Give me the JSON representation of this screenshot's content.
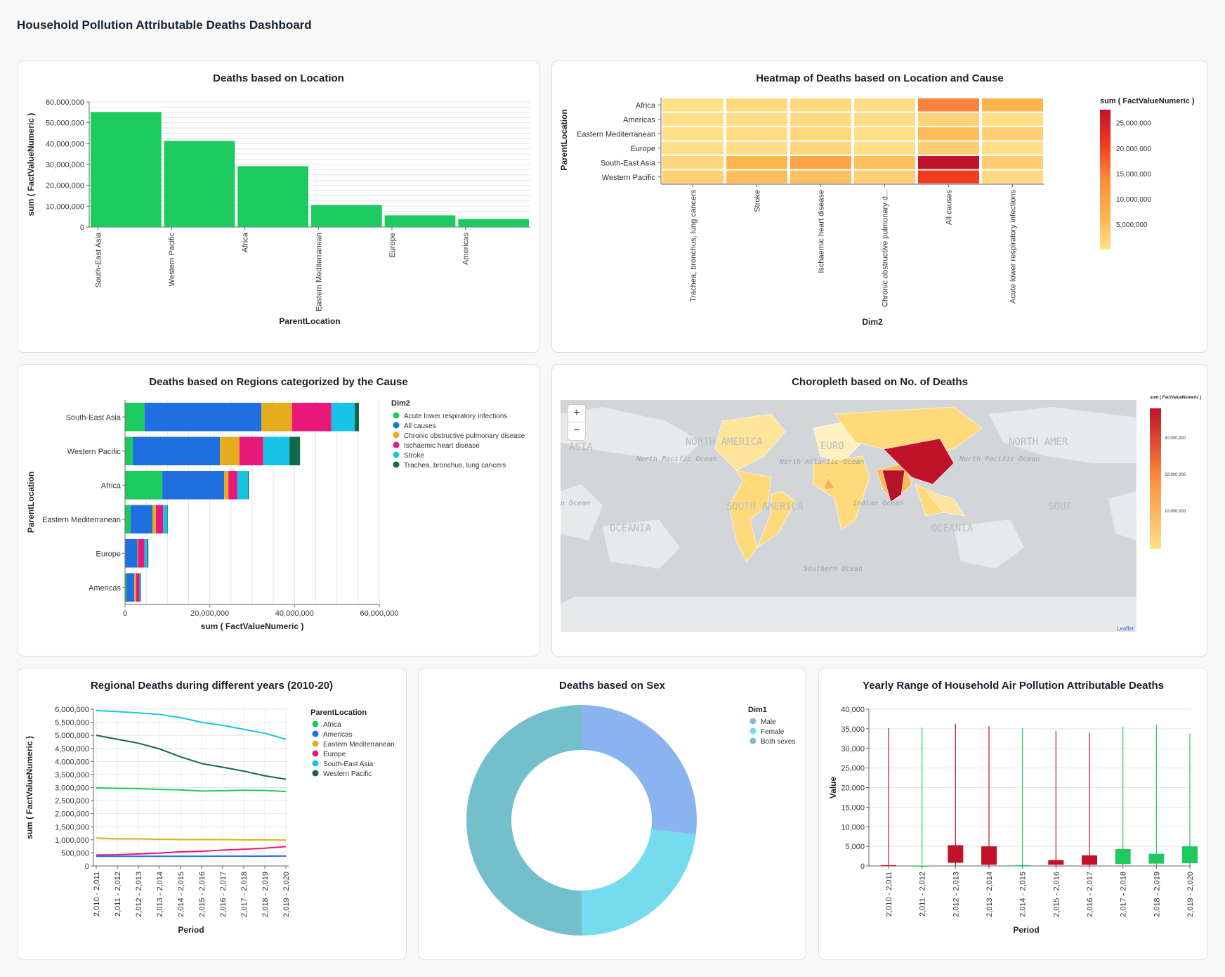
{
  "dashboard_title": "Household Pollution Attributable Deaths Dashboard",
  "cards": {
    "location": {
      "title": "Deaths based on Location"
    },
    "heatmap": {
      "title": "Heatmap of Deaths based on Location and Cause"
    },
    "stacked": {
      "title": "Deaths based on Regions categorized by the Cause"
    },
    "choropleth": {
      "title": "Choropleth based on No. of Deaths"
    },
    "yearly_lines": {
      "title": "Regional Deaths during different years (2010-20)"
    },
    "sex": {
      "title": "Deaths based on Sex"
    },
    "range": {
      "title": "Yearly Range of Household Air Pollution Attributable Deaths"
    }
  },
  "map": {
    "zoom_in": "+",
    "zoom_out": "−",
    "attribution": "Leaflet",
    "legend_title": "sum ( FactValueNumeric )",
    "legend_ticks": [
      "30,000,000",
      "20,000,000",
      "10,000,000"
    ],
    "labels": [
      "ASIA",
      "NORTH AMERICA",
      "EURO",
      "NORTH AMER",
      "North Pacific Ocean",
      "North Atlantic Ocean",
      "North Pacific Ocean",
      "SOUTH AMERICA",
      "Indian Ocean",
      "OCEANIA",
      "OCEANIA",
      "Southern Ocean",
      "n Ocean",
      "SOUT"
    ],
    "colors": {
      "ocean": "#d3d6d9",
      "land": "#e8e9ea",
      "low": "#ffd97a",
      "high": "#c0132a"
    }
  },
  "chart_data": [
    {
      "id": "location",
      "type": "bar",
      "title": "Deaths based on Location",
      "xlabel": "ParentLocation",
      "ylabel": "sum ( FactValueNumeric )",
      "categories": [
        "South-East Asia",
        "Western Pacific",
        "Africa",
        "Eastern Mediterranean",
        "Europe",
        "Americas"
      ],
      "values": [
        55200000,
        41300000,
        29200000,
        10500000,
        5600000,
        3800000
      ],
      "ylim": [
        0,
        60000000
      ],
      "yticks": [
        "0",
        "10,000,000",
        "20,000,000",
        "30,000,000",
        "40,000,000",
        "50,000,000",
        "60,000,000"
      ],
      "color": "#1dca5f",
      "grid": true
    },
    {
      "id": "heatmap",
      "type": "heatmap",
      "title": "Heatmap of Deaths based on Location and Cause",
      "xlabel": "Dim2",
      "ylabel": "ParentLocation",
      "y": [
        "Africa",
        "Americas",
        "Eastern Mediterranean",
        "Europe",
        "South-East Asia",
        "Western Pacific"
      ],
      "x": [
        "Trachea, bronchus, lung cancers",
        "Stroke",
        "Ischaemic heart disease",
        "Chronic obstructive pulmonary d...",
        "All causes",
        "Acute lower respiratory infections"
      ],
      "values": [
        [
          200000,
          1100000,
          1100000,
          300000,
          14600000,
          6800000
        ],
        [
          200000,
          400000,
          900000,
          400000,
          1900000,
          300000
        ],
        [
          100000,
          700000,
          1400000,
          100000,
          5200000,
          2600000
        ],
        [
          200000,
          600000,
          1500000,
          300000,
          2800000,
          200000
        ],
        [
          1700000,
          6500000,
          9700000,
          5000000,
          27600000,
          3000000
        ],
        [
          2600000,
          5300000,
          4900000,
          2500000,
          20600000,
          1000000
        ]
      ],
      "legend_title": "sum ( FactValueNumeric )",
      "legend_ticks": [
        "25,000,000",
        "20,000,000",
        "15,000,000",
        "10,000,000",
        "5,000,000"
      ],
      "color_range": [
        "#ffe08a",
        "#c0132a"
      ]
    },
    {
      "id": "stacked",
      "type": "bar",
      "orientation": "horizontal-stacked",
      "title": "Deaths based on Regions categorized by the Cause",
      "xlabel": "sum ( FactValueNumeric )",
      "ylabel": "ParentLocation",
      "categories": [
        "South-East Asia",
        "Western Pacific",
        "Africa",
        "Eastern Mediterranean",
        "Europe",
        "Americas"
      ],
      "xlim": [
        0,
        60000000
      ],
      "xticks": [
        "0",
        "20,000,000",
        "40,000,000",
        "60,000,000"
      ],
      "legend_title": "Dim2",
      "series": [
        {
          "name": "Acute lower respiratory infections",
          "color": "#1dca5f",
          "values": [
            4600000,
            1800000,
            8800000,
            1300000,
            100000,
            300000
          ]
        },
        {
          "name": "All causes",
          "color": "#1f6fe0",
          "values": [
            27600000,
            20600000,
            14600000,
            5200000,
            2800000,
            1900000
          ]
        },
        {
          "name": "Chronic obstructive pulmonary disease",
          "color": "#e3ad1d",
          "values": [
            7200000,
            4600000,
            1000000,
            800000,
            200000,
            400000
          ]
        },
        {
          "name": "Ischaemic heart disease",
          "color": "#e8187a",
          "values": [
            9300000,
            5600000,
            2100000,
            1700000,
            1500000,
            800000
          ]
        },
        {
          "name": "Stroke",
          "color": "#18c4e6",
          "values": [
            5500000,
            6200000,
            2500000,
            1000000,
            700000,
            300000
          ]
        },
        {
          "name": "Trachea, bronchus, lung cancers",
          "color": "#11694a",
          "values": [
            1000000,
            2500000,
            200000,
            100000,
            200000,
            100000
          ]
        }
      ]
    },
    {
      "id": "yearly_lines",
      "type": "line",
      "title": "Regional Deaths during different years (2010-20)",
      "xlabel": "Period",
      "ylabel": "sum ( FactValueNumeric )",
      "x": [
        "2,010 - 2,011",
        "2,011 - 2,012",
        "2,012 - 2,013",
        "2,013 - 2,014",
        "2,014 - 2,015",
        "2,015 - 2,016",
        "2,016 - 2,017",
        "2,017 - 2,018",
        "2,018 - 2,019",
        "2,019 - 2,020"
      ],
      "ylim": [
        0,
        6000000
      ],
      "yticks": [
        "0",
        "500,000",
        "1,000,000",
        "1,500,000",
        "2,000,000",
        "2,500,000",
        "3,000,000",
        "3,500,000",
        "4,000,000",
        "4,500,000",
        "5,000,000",
        "5,500,000",
        "6,000,000"
      ],
      "legend_title": "ParentLocation",
      "series": [
        {
          "name": "Africa",
          "color": "#1dca5f",
          "values": [
            2990000,
            2970000,
            2960000,
            2930000,
            2910000,
            2870000,
            2880000,
            2900000,
            2890000,
            2850000
          ]
        },
        {
          "name": "Americas",
          "color": "#1f6fe0",
          "values": [
            370000,
            370000,
            370000,
            370000,
            370000,
            370000,
            375000,
            375000,
            375000,
            380000
          ]
        },
        {
          "name": "Eastern Mediterranean",
          "color": "#e3ad1d",
          "values": [
            1070000,
            1040000,
            1040000,
            1020000,
            1010000,
            1010000,
            1010000,
            1000000,
            1000000,
            990000
          ]
        },
        {
          "name": "Europe",
          "color": "#e8187a",
          "values": [
            420000,
            430000,
            460000,
            490000,
            540000,
            560000,
            610000,
            640000,
            680000,
            740000
          ]
        },
        {
          "name": "South-East Asia",
          "color": "#18c4e6",
          "values": [
            5950000,
            5910000,
            5860000,
            5800000,
            5680000,
            5500000,
            5380000,
            5230000,
            5080000,
            4850000
          ]
        },
        {
          "name": "Western Pacific",
          "color": "#11694a",
          "values": [
            5000000,
            4850000,
            4700000,
            4480000,
            4180000,
            3920000,
            3780000,
            3630000,
            3450000,
            3320000
          ]
        }
      ]
    },
    {
      "id": "sex",
      "type": "pie",
      "title": "Deaths based on Sex",
      "legend_title": "Dim1",
      "series": [
        {
          "name": "Male",
          "color": "#8ab4f0",
          "value": 27
        },
        {
          "name": "Female",
          "color": "#75dbee",
          "value": 23
        },
        {
          "name": "Both sexes",
          "color": "#74bfcc",
          "value": 50
        }
      ]
    },
    {
      "id": "range",
      "type": "bar",
      "subtype": "candlestick",
      "title": "Yearly Range of Household Air Pollution Attributable Deaths",
      "xlabel": "Period",
      "ylabel": "Value",
      "x": [
        "2,010 - 2,011",
        "2,011 - 2,012",
        "2,012 - 2,013",
        "2,013 - 2,014",
        "2,014 - 2,015",
        "2,015 - 2,016",
        "2,016 - 2,017",
        "2,017 - 2,018",
        "2,018 - 2,019",
        "2,019 - 2,020"
      ],
      "ylim": [
        0,
        40000
      ],
      "yticks": [
        "0",
        "5,000",
        "10,000",
        "15,000",
        "20,000",
        "25,000",
        "30,000",
        "35,000",
        "40,000"
      ],
      "colors": {
        "up": "#1dca5f",
        "down": "#c0132a"
      },
      "values": [
        {
          "low": 0,
          "high": 35200,
          "open": 200,
          "close": 0,
          "dir": "down"
        },
        {
          "low": 0,
          "high": 35300,
          "open": 0,
          "close": 100,
          "dir": "up"
        },
        {
          "low": 0,
          "high": 36200,
          "open": 5300,
          "close": 800,
          "dir": "down"
        },
        {
          "low": 0,
          "high": 35700,
          "open": 5000,
          "close": 300,
          "dir": "down"
        },
        {
          "low": 0,
          "high": 35200,
          "open": 0,
          "close": 200,
          "dir": "up"
        },
        {
          "low": 0,
          "high": 34400,
          "open": 1500,
          "close": 300,
          "dir": "down"
        },
        {
          "low": 0,
          "high": 34000,
          "open": 2700,
          "close": 300,
          "dir": "down"
        },
        {
          "low": 0,
          "high": 35500,
          "open": 500,
          "close": 4300,
          "dir": "up"
        },
        {
          "low": 0,
          "high": 36000,
          "open": 600,
          "close": 3100,
          "dir": "up"
        },
        {
          "low": 0,
          "high": 33800,
          "open": 700,
          "close": 5000,
          "dir": "up"
        }
      ]
    }
  ]
}
